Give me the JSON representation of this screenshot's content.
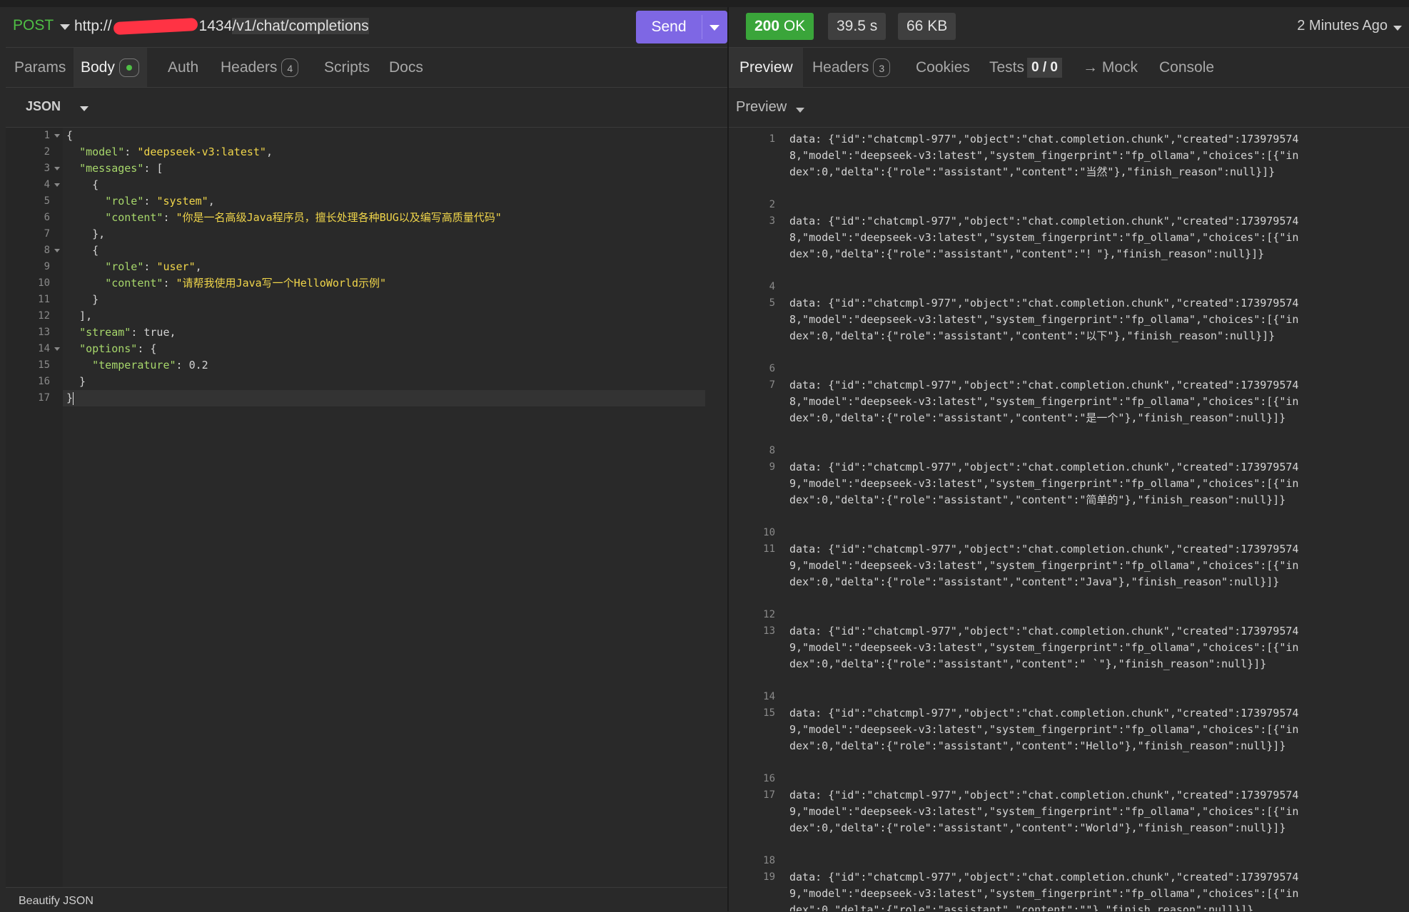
{
  "request": {
    "method": "POST",
    "url_prefix": "http://",
    "url_hidden_tail": "1434",
    "url_path": "/v1/chat/completions",
    "send_label": "Send"
  },
  "request_tabs": [
    {
      "label": "Params"
    },
    {
      "label": "Body"
    },
    {
      "label": "Auth"
    },
    {
      "label": "Headers",
      "badge": "4"
    },
    {
      "label": "Scripts"
    },
    {
      "label": "Docs"
    }
  ],
  "body_format": "JSON",
  "body_footer": "Beautify JSON",
  "response": {
    "status": "200",
    "status_text": "OK",
    "time": "39.5 s",
    "size": "66 KB",
    "ago": "2 Minutes Ago"
  },
  "response_tabs": [
    {
      "label": "Preview"
    },
    {
      "label": "Headers",
      "badge": "3"
    },
    {
      "label": "Cookies"
    },
    {
      "label": "Tests",
      "badge": "0 / 0"
    },
    {
      "label": "→ Mock"
    },
    {
      "label": "Console"
    }
  ],
  "preview_mode": "Preview",
  "body_lines": [
    {
      "n": "1",
      "fold": true
    },
    {
      "n": "2"
    },
    {
      "n": "3",
      "fold": true
    },
    {
      "n": "4",
      "fold": true
    },
    {
      "n": "5"
    },
    {
      "n": "6"
    },
    {
      "n": "7"
    },
    {
      "n": "8",
      "fold": true
    },
    {
      "n": "9"
    },
    {
      "n": "10"
    },
    {
      "n": "11"
    },
    {
      "n": "12"
    },
    {
      "n": "13"
    },
    {
      "n": "14",
      "fold": true
    },
    {
      "n": "15"
    },
    {
      "n": "16"
    },
    {
      "n": "17"
    }
  ],
  "body_code": {
    "l1": "{",
    "l2_key": "\"model\"",
    "l2_val": "\"deepseek-v3:latest\"",
    "l3_key": "\"messages\"",
    "l4": "    {",
    "l5_key": "\"role\"",
    "l5_val": "\"system\"",
    "l6_key": "\"content\"",
    "l6_val": "\"你是一名高级Java程序员，擅长处理各种BUG以及编写高质量代码\"",
    "l7": "    },",
    "l8": "    {",
    "l9_key": "\"role\"",
    "l9_val": "\"user\"",
    "l10_key": "\"content\"",
    "l10_val": "\"请帮我使用Java写一个HelloWorld示例\"",
    "l11": "    }",
    "l12": "  ],",
    "l13_key": "\"stream\"",
    "l13_val": "true",
    "l14_key": "\"options\"",
    "l15_key": "\"temperature\"",
    "l15_val": "0.2",
    "l16": "  }",
    "l17": "}"
  },
  "stream_lines": [
    {
      "n": "1",
      "text": "data: {\"id\":\"chatcmpl-977\",\"object\":\"chat.completion.chunk\",\"created\":1739795748,\"model\":\"deepseek-v3:latest\",\"system_fingerprint\":\"fp_ollama\",\"choices\":[{\"index\":0,\"delta\":{\"role\":\"assistant\",\"content\":\"当然\"},\"finish_reason\":null}]}"
    },
    {
      "n": "2",
      "text": ""
    },
    {
      "n": "3",
      "text": "data: {\"id\":\"chatcmpl-977\",\"object\":\"chat.completion.chunk\",\"created\":1739795748,\"model\":\"deepseek-v3:latest\",\"system_fingerprint\":\"fp_ollama\",\"choices\":[{\"index\":0,\"delta\":{\"role\":\"assistant\",\"content\":\"！\"},\"finish_reason\":null}]}"
    },
    {
      "n": "4",
      "text": ""
    },
    {
      "n": "5",
      "text": "data: {\"id\":\"chatcmpl-977\",\"object\":\"chat.completion.chunk\",\"created\":1739795748,\"model\":\"deepseek-v3:latest\",\"system_fingerprint\":\"fp_ollama\",\"choices\":[{\"index\":0,\"delta\":{\"role\":\"assistant\",\"content\":\"以下\"},\"finish_reason\":null}]}"
    },
    {
      "n": "6",
      "text": ""
    },
    {
      "n": "7",
      "text": "data: {\"id\":\"chatcmpl-977\",\"object\":\"chat.completion.chunk\",\"created\":1739795748,\"model\":\"deepseek-v3:latest\",\"system_fingerprint\":\"fp_ollama\",\"choices\":[{\"index\":0,\"delta\":{\"role\":\"assistant\",\"content\":\"是一个\"},\"finish_reason\":null}]}"
    },
    {
      "n": "8",
      "text": ""
    },
    {
      "n": "9",
      "text": "data: {\"id\":\"chatcmpl-977\",\"object\":\"chat.completion.chunk\",\"created\":1739795749,\"model\":\"deepseek-v3:latest\",\"system_fingerprint\":\"fp_ollama\",\"choices\":[{\"index\":0,\"delta\":{\"role\":\"assistant\",\"content\":\"简单的\"},\"finish_reason\":null}]}"
    },
    {
      "n": "10",
      "text": ""
    },
    {
      "n": "11",
      "text": "data: {\"id\":\"chatcmpl-977\",\"object\":\"chat.completion.chunk\",\"created\":1739795749,\"model\":\"deepseek-v3:latest\",\"system_fingerprint\":\"fp_ollama\",\"choices\":[{\"index\":0,\"delta\":{\"role\":\"assistant\",\"content\":\"Java\"},\"finish_reason\":null}]}"
    },
    {
      "n": "12",
      "text": ""
    },
    {
      "n": "13",
      "text": "data: {\"id\":\"chatcmpl-977\",\"object\":\"chat.completion.chunk\",\"created\":1739795749,\"model\":\"deepseek-v3:latest\",\"system_fingerprint\":\"fp_ollama\",\"choices\":[{\"index\":0,\"delta\":{\"role\":\"assistant\",\"content\":\" `\"},\"finish_reason\":null}]}"
    },
    {
      "n": "14",
      "text": ""
    },
    {
      "n": "15",
      "text": "data: {\"id\":\"chatcmpl-977\",\"object\":\"chat.completion.chunk\",\"created\":1739795749,\"model\":\"deepseek-v3:latest\",\"system_fingerprint\":\"fp_ollama\",\"choices\":[{\"index\":0,\"delta\":{\"role\":\"assistant\",\"content\":\"Hello\"},\"finish_reason\":null}]}"
    },
    {
      "n": "16",
      "text": ""
    },
    {
      "n": "17",
      "text": "data: {\"id\":\"chatcmpl-977\",\"object\":\"chat.completion.chunk\",\"created\":1739795749,\"model\":\"deepseek-v3:latest\",\"system_fingerprint\":\"fp_ollama\",\"choices\":[{\"index\":0,\"delta\":{\"role\":\"assistant\",\"content\":\"World\"},\"finish_reason\":null}]}"
    },
    {
      "n": "18",
      "text": ""
    },
    {
      "n": "19",
      "text": "data: {\"id\":\"chatcmpl-977\",\"object\":\"chat.completion.chunk\",\"created\":1739795749,\"model\":\"deepseek-v3:latest\",\"system_fingerprint\":\"fp_ollama\",\"choices\":[{\"index\":0,\"delta\":{\"role\":\"assistant\",\"content\":\"\"},\"finish_reason\":null}]}"
    }
  ]
}
